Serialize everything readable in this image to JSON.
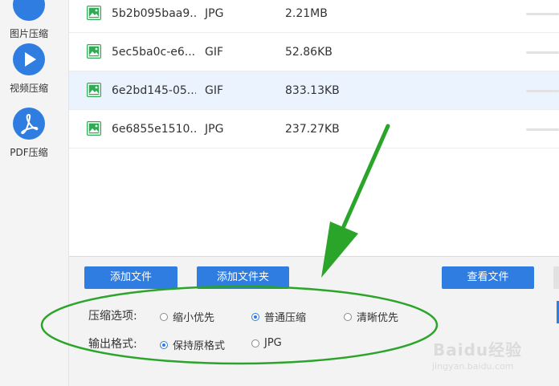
{
  "sidebar": {
    "items": [
      {
        "label": "图片压缩",
        "icon": "image-compress-icon"
      },
      {
        "label": "视频压缩",
        "icon": "play-icon"
      },
      {
        "label": "PDF压缩",
        "icon": "pdf-icon"
      }
    ]
  },
  "files": [
    {
      "name": "5b2b095baa9...",
      "type": "JPG",
      "size": "2.21MB",
      "selected": false
    },
    {
      "name": "5ec5ba0c-e6...",
      "type": "GIF",
      "size": "52.86KB",
      "selected": false
    },
    {
      "name": "6e2bd145-05...",
      "type": "GIF",
      "size": "833.13KB",
      "selected": true
    },
    {
      "name": "6e6855e1510...",
      "type": "JPG",
      "size": "237.27KB",
      "selected": false
    }
  ],
  "buttons": {
    "add_file": "添加文件",
    "add_folder": "添加文件夹",
    "view_files": "查看文件"
  },
  "options": {
    "compress_label": "压缩选项:",
    "compress_choices": [
      {
        "label": "缩小优先",
        "checked": false
      },
      {
        "label": "普通压缩",
        "checked": true
      },
      {
        "label": "清晰优先",
        "checked": false
      }
    ],
    "format_label": "输出格式:",
    "format_choices": [
      {
        "label": "保持原格式",
        "checked": true
      },
      {
        "label": "JPG",
        "checked": false
      }
    ]
  },
  "watermark": {
    "text": "Baidu经验",
    "sub": "jingyan.baidu.com"
  },
  "colors": {
    "accent": "#2f7de1",
    "annotation": "#2aa52a",
    "file_icon": "#2fab55",
    "selected_row": "#eaf3fe"
  }
}
